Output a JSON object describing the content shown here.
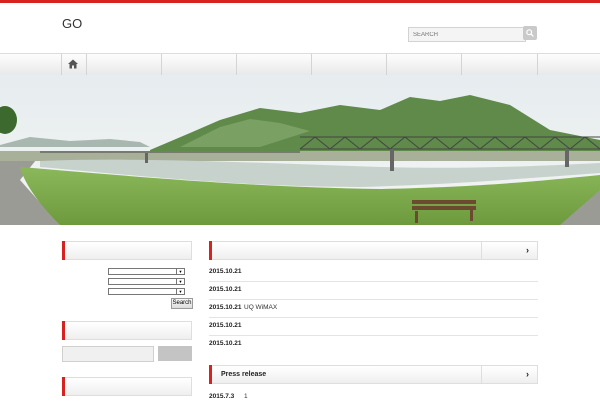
{
  "site": {
    "title": "GO"
  },
  "search": {
    "placeholder": "SEARCH"
  },
  "news": {
    "rows": [
      {
        "date": "2015.10.21",
        "text": ""
      },
      {
        "date": "2015.10.21",
        "text": ""
      },
      {
        "date": "2015.10.21",
        "text": "UQ WiMAX"
      },
      {
        "date": "2015.10.21",
        "text": ""
      },
      {
        "date": "2015.10.21",
        "text": ""
      }
    ],
    "more": "›"
  },
  "press": {
    "title": "Press release",
    "more": "›",
    "rows": [
      {
        "date": "2015.7.3",
        "text": "1"
      }
    ]
  },
  "sidebar": {
    "search_button": "Search"
  },
  "colors": {
    "accent": "#d7221f"
  }
}
